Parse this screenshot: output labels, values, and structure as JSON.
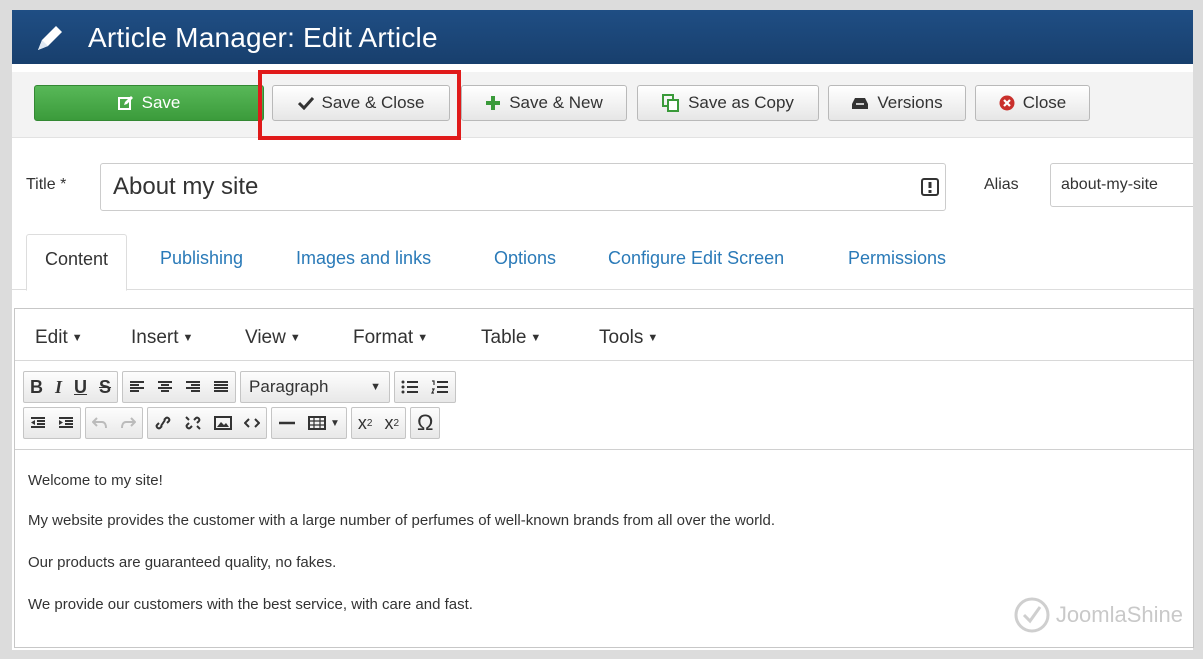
{
  "header": {
    "title": "Article Manager: Edit Article",
    "icon": "pencil-icon"
  },
  "toolbar": {
    "save": "Save",
    "save_close": "Save & Close",
    "save_new": "Save & New",
    "save_copy": "Save as Copy",
    "versions": "Versions",
    "close": "Close"
  },
  "form": {
    "title_label": "Title *",
    "title_value": "About my site",
    "alias_label": "Alias",
    "alias_value": "about-my-site"
  },
  "tabs": [
    "Content",
    "Publishing",
    "Images and links",
    "Options",
    "Configure Edit Screen",
    "Permissions"
  ],
  "editor": {
    "menus": [
      "Edit",
      "Insert",
      "View",
      "Format",
      "Table",
      "Tools"
    ],
    "paragraph_select": "Paragraph",
    "content": [
      "Welcome to my site!",
      "My website provides the customer with a large number of perfumes of well-known brands from all over the world.",
      "Our products are guaranteed quality, no fakes.",
      "We provide our customers with the best service, with care and fast."
    ]
  },
  "watermark": "JoomlaShine",
  "colors": {
    "header_bg": "#1b4678",
    "save_green": "#46a946",
    "highlight_red": "#e01a1a",
    "link_blue": "#2a7ab8"
  }
}
